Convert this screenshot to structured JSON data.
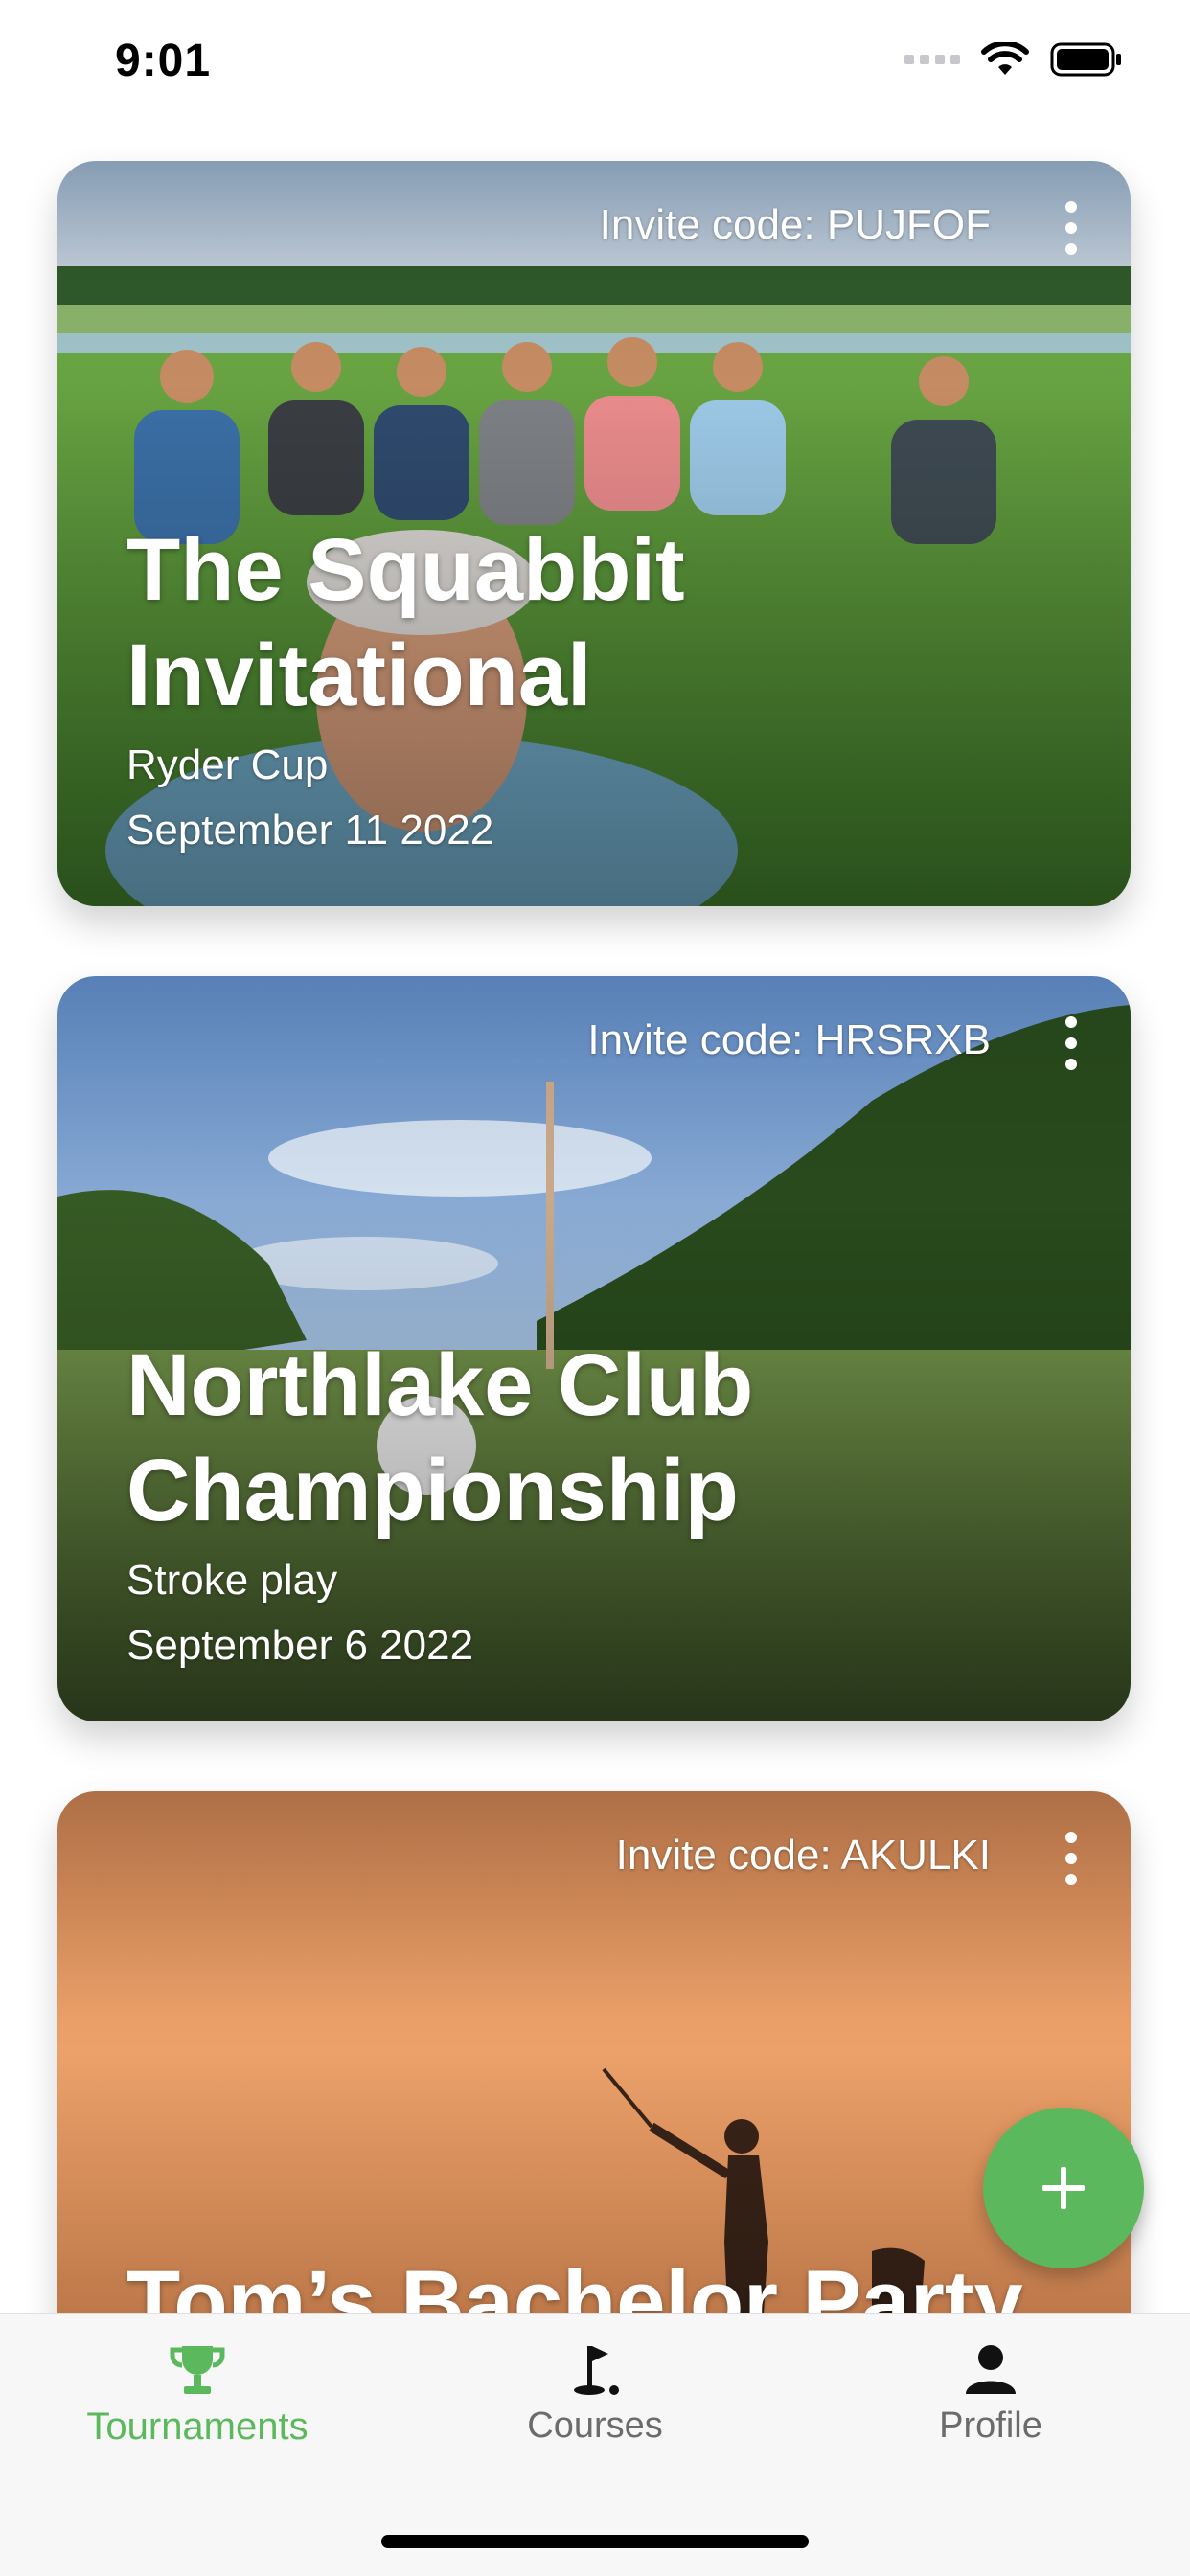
{
  "status_bar": {
    "time": "9:01"
  },
  "tournaments": [
    {
      "invite_label": "Invite code:",
      "invite_code": "PUJFOF",
      "title": "The Squabbit Invitational",
      "format": "Ryder Cup",
      "date": "September 11 2022"
    },
    {
      "invite_label": "Invite code:",
      "invite_code": "HRSRXB",
      "title": "Northlake Club Championship",
      "format": "Stroke play",
      "date": "September 6 2022"
    },
    {
      "invite_label": "Invite code:",
      "invite_code": "AKULKI",
      "title": "Tom’s Bachelor Party",
      "format": "",
      "date": ""
    }
  ],
  "fab": {
    "icon": "plus-icon"
  },
  "tab_bar": {
    "tabs": [
      {
        "label": "Tournaments",
        "icon": "trophy-icon",
        "active": true
      },
      {
        "label": "Courses",
        "icon": "golf-flag-icon",
        "active": false
      },
      {
        "label": "Profile",
        "icon": "person-icon",
        "active": false
      }
    ]
  },
  "colors": {
    "accent": "#5cb85c",
    "inactive": "#6b6b6b",
    "tab_bg": "#f7f7f7"
  }
}
